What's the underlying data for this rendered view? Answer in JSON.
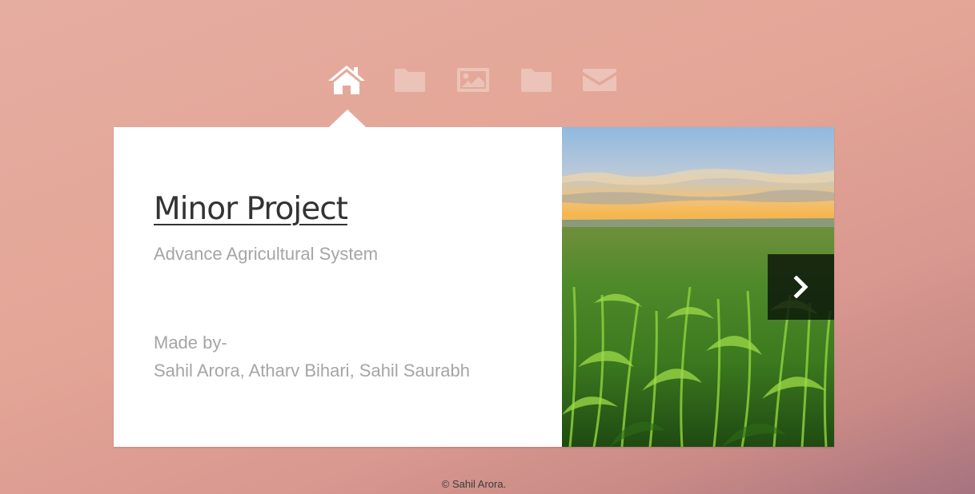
{
  "nav": {
    "items": [
      {
        "icon": "home-icon",
        "active": true
      },
      {
        "icon": "folder-icon",
        "active": false
      },
      {
        "icon": "image-icon",
        "active": false
      },
      {
        "icon": "folder-icon",
        "active": false
      },
      {
        "icon": "envelope-icon",
        "active": false
      }
    ],
    "active_color": "#ffffff",
    "inactive_color": "#ecc3b8"
  },
  "main": {
    "title": "Minor Project",
    "subtitle": "Advance Agricultural System",
    "made_by_label": "Made by-",
    "authors": "Sahil Arora, Atharv Bihari, Sahil Saurabh"
  },
  "slider": {
    "image": "cornfield-photo",
    "next_icon": "chevron-right-icon"
  },
  "footer": {
    "text": "© Sahil Arora."
  }
}
